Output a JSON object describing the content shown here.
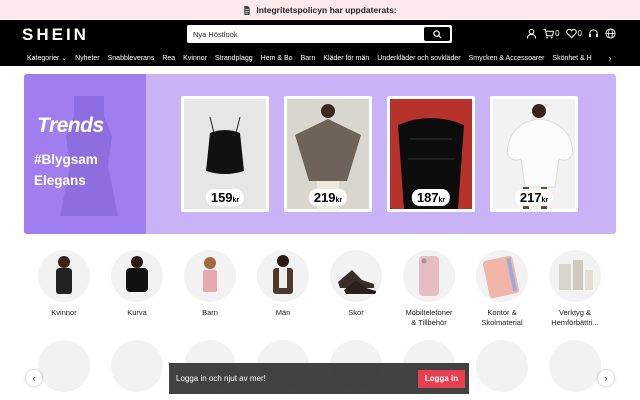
{
  "notice": {
    "text": "Integritetspolicyn har uppdaterats:"
  },
  "header": {
    "logo": "SHEIN",
    "search_value": "Nya Höstlook",
    "cart_count": "0",
    "wishlist_count": "0"
  },
  "nav": {
    "items": [
      "Kategorier",
      "Nyheter",
      "Snabbleverans",
      "Rea",
      "Kvinnor",
      "Strandplagg",
      "Hem & Bo",
      "Barn",
      "Kläder för män",
      "Underkläder och sovkläder",
      "Smycken & Accessoarer",
      "Skönhet & H"
    ]
  },
  "banner": {
    "brand": "Trends",
    "tag_line1": "#Blygsam",
    "tag_line2": "Elegans",
    "currency": "kr",
    "products": [
      {
        "price": "159"
      },
      {
        "price": "219"
      },
      {
        "price": "187"
      },
      {
        "price": "217"
      }
    ]
  },
  "categories": [
    {
      "label": "Kvinnor"
    },
    {
      "label": "Kurva"
    },
    {
      "label": "Barn"
    },
    {
      "label": "Män"
    },
    {
      "label": "Skor"
    },
    {
      "label": "Mobiltelefoner\n& Tillbehör"
    },
    {
      "label": "Kontor &\nSkolmaterial"
    },
    {
      "label": "Verktyg &\nHemförbättri..."
    }
  ],
  "login": {
    "text": "Logga in och njut av mer!",
    "button": "Logga in"
  },
  "colors": {
    "accent": "#e8404f",
    "banner_bg": "#c9b3f7",
    "banner_left": "#a07ef0"
  }
}
